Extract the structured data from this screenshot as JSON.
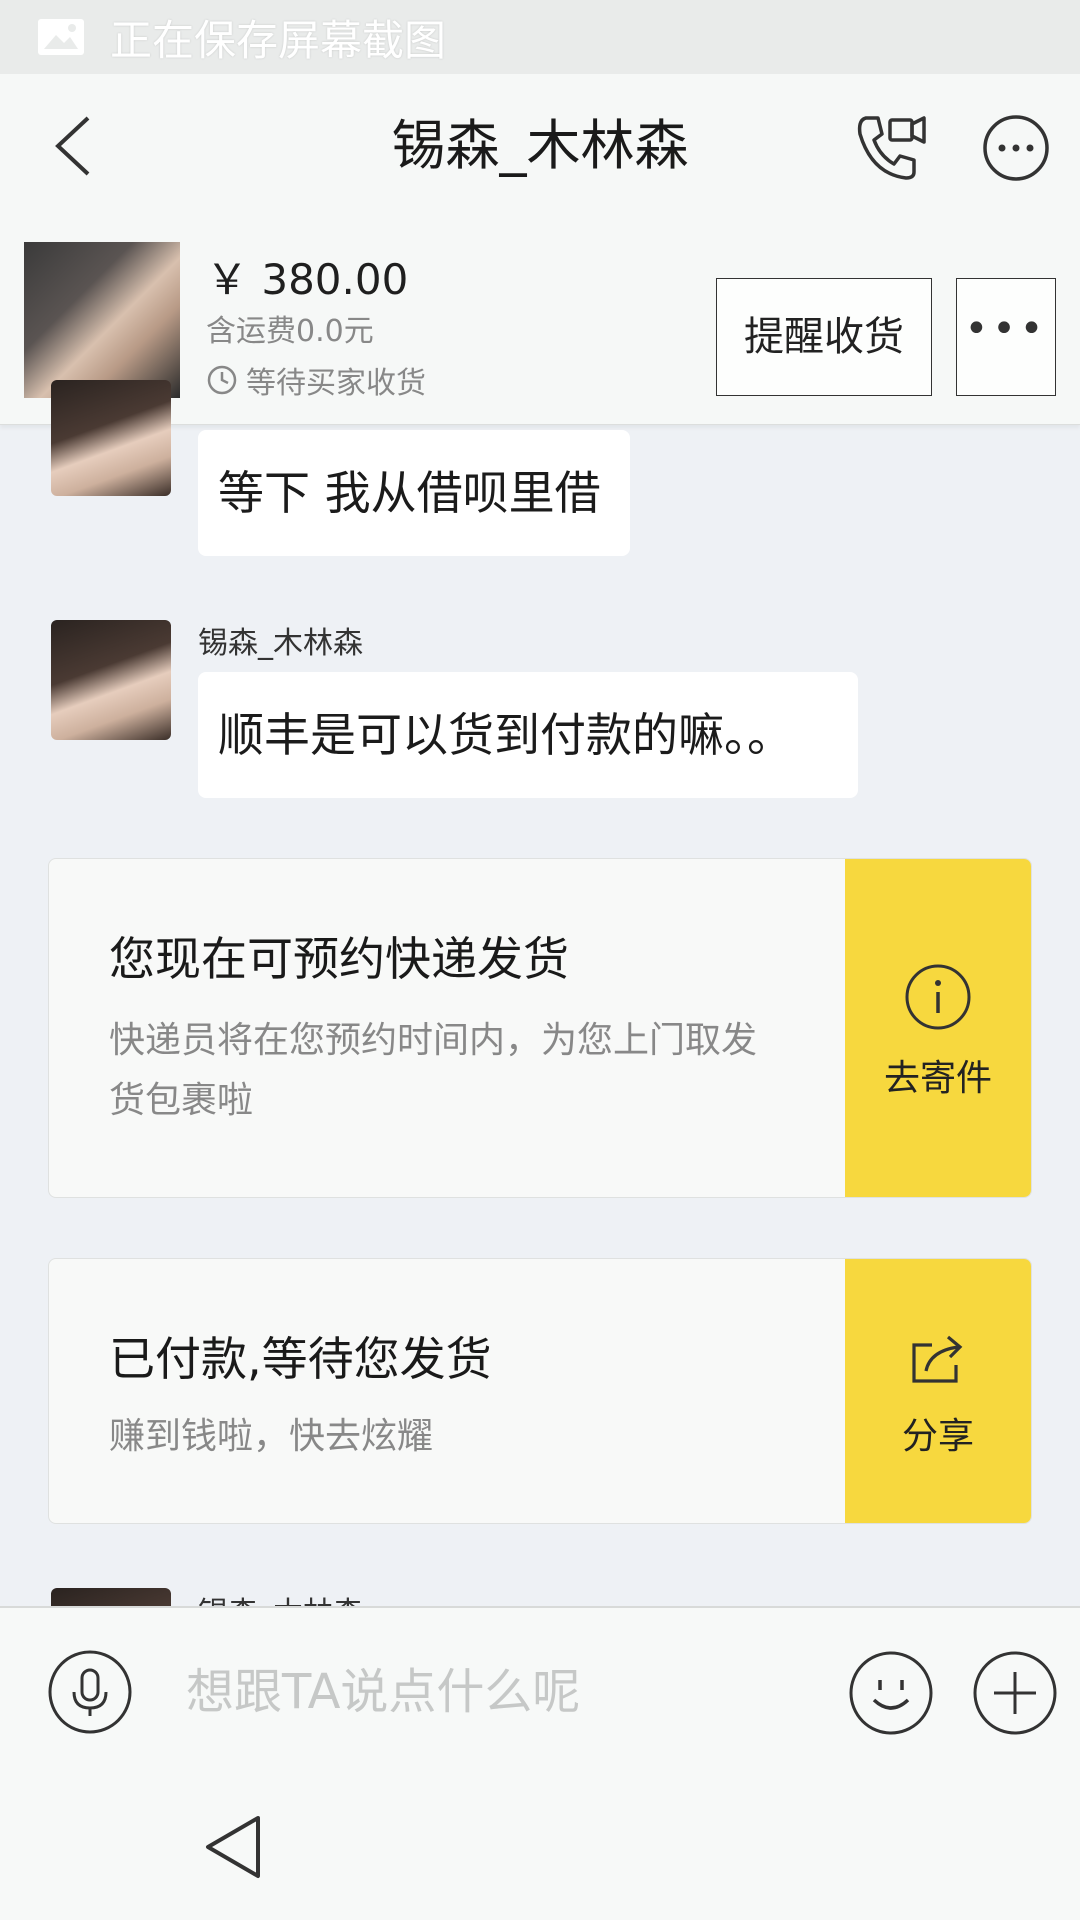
{
  "status_bar": {
    "text": "正在保存屏幕截图",
    "icon": "image-icon"
  },
  "nav": {
    "title": "锡森_木林森",
    "back_icon": "chevron-left-icon",
    "call_icon": "phone-video-icon",
    "more_icon": "more-circle-icon"
  },
  "order": {
    "price": "￥ 380.00",
    "shipping": "含运费0.0元",
    "status": "等待买家收货",
    "status_icon": "clock-icon",
    "remind_label": "提醒收货",
    "more_label": "•••"
  },
  "messages": [
    {
      "sender": "",
      "text": "等下 我从借呗里借"
    },
    {
      "sender": "锡森_木林森",
      "text": "顺丰是可以货到付款的嘛。。"
    }
  ],
  "cards": [
    {
      "title": "您现在可预约快递发货",
      "desc": "快递员将在您预约时间内，为您上门取发货包裹啦",
      "action_label": "去寄件",
      "action_icon": "info-icon"
    },
    {
      "title": "已付款,等待您发货",
      "desc": "赚到钱啦，快去炫耀",
      "action_label": "分享",
      "action_icon": "share-icon"
    }
  ],
  "partial_sender": "锡森_木林森",
  "input": {
    "placeholder": "想跟TA说点什么呢"
  },
  "colors": {
    "accent": "#f7d83e",
    "background": "#eef1f5"
  }
}
